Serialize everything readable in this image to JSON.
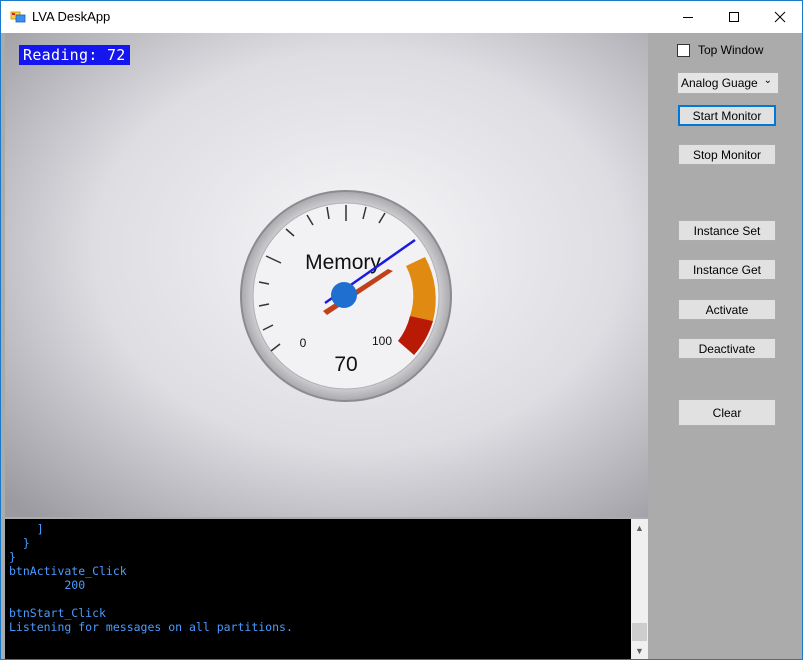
{
  "window": {
    "title": "LVA DeskApp"
  },
  "controls": {
    "minimize": "—",
    "maximize": "☐",
    "close": "✕"
  },
  "video": {
    "reading_label": "Reading: 72",
    "gauge": {
      "title": "Memory",
      "value_text": "70",
      "min_label": "0",
      "max_label": "100",
      "needle_value": 72
    }
  },
  "console": {
    "lines": "    ]\n  }\n}\nbtnActivate_Click\n        200\n\nbtnStart_Click\nListening for messages on all partitions."
  },
  "panel": {
    "top_window_label": "Top Window",
    "top_window_checked": false,
    "mode_select": "Analog Guage",
    "buttons": {
      "start": "Start Monitor",
      "stop": "Stop Monitor",
      "instance_set": "Instance Set",
      "instance_get": "Instance Get",
      "activate": "Activate",
      "deactivate": "Deactivate",
      "clear": "Clear"
    }
  },
  "colors": {
    "accent": "#0078d7",
    "reading_bg": "#1515f0",
    "console_text": "#4b9bff",
    "gauge_orange": "#e08a12",
    "gauge_red": "#b81a06"
  }
}
